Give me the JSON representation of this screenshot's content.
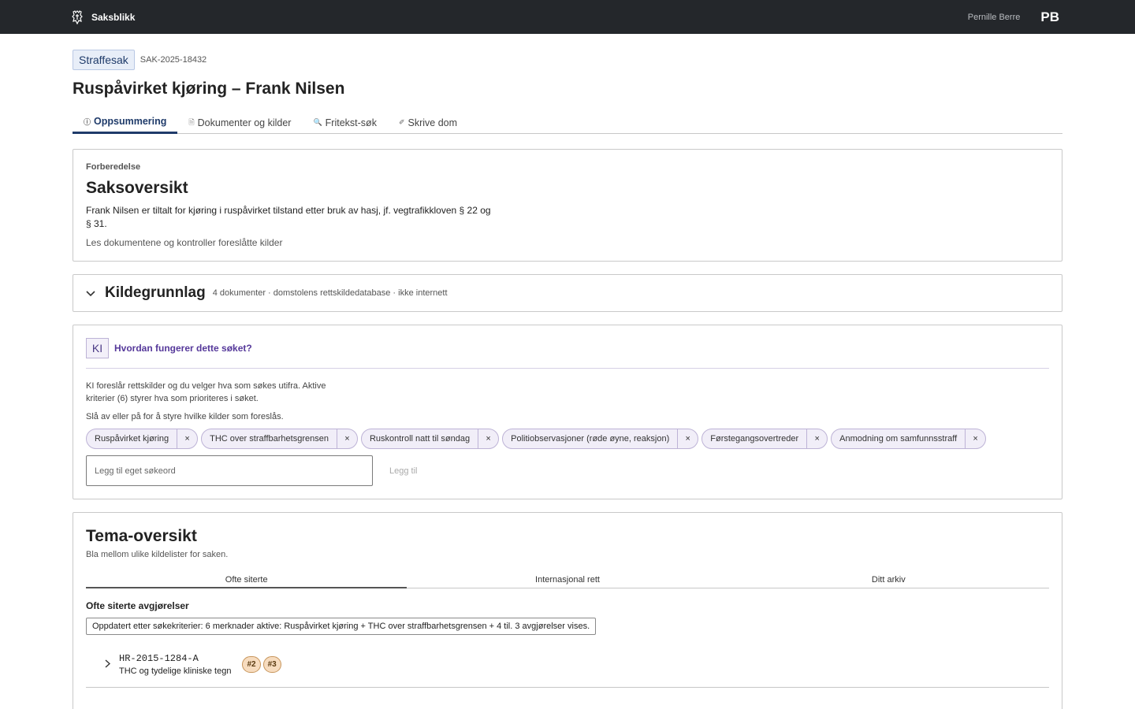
{
  "topbar": {
    "app_name": "Saksblikk",
    "user_name": "Pernille Berre",
    "user_initials": "PB"
  },
  "case": {
    "type": "Straffesak",
    "id": "SAK-2025-18432",
    "title": "Ruspåvirket kjøring – Frank Nilsen"
  },
  "tabs": [
    {
      "label": "Oppsummering",
      "icon": "info-icon",
      "active": true
    },
    {
      "label": "Dokumenter og kilder",
      "icon": "document-icon",
      "active": false
    },
    {
      "label": "Fritekst-søk",
      "icon": "search-icon",
      "active": false
    },
    {
      "label": "Skrive dom",
      "icon": "pen-icon",
      "active": false
    }
  ],
  "overview": {
    "overline": "Forberedelse",
    "title": "Saksoversikt",
    "summary": "Frank Nilsen er tiltalt for kjøring i ruspåvirket tilstand etter bruk av hasj, jf. vegtrafikkloven § 22 og § 31.",
    "instruction": "Les dokumentene og kontroller foreslåtte kilder"
  },
  "sources": {
    "title": "Kildegrunnlag",
    "meta": "4 dokumenter · domstolens rettskildedatabase · ikke internett"
  },
  "ki": {
    "badge": "KI",
    "link": "Hvordan fungerer dette søket?",
    "text": "KI foreslår rettskilder og du velger hva som søkes utifra. Aktive kriterier (6) styrer hva som prioriteres i søket.",
    "text2": "Slå av eller på for å styre hvilke kilder som foreslås.",
    "chips": [
      "Ruspåvirket kjøring",
      "THC over straffbarhetsgrensen",
      "Ruskontroll natt til søndag",
      "Politiobservasjoner (røde øyne, reaksjon)",
      "Førstegangsovertreder",
      "Anmodning om samfunnsstraff"
    ],
    "remove_glyph": "×",
    "input_placeholder": "Legg til eget søkeord",
    "add_label": "Legg til"
  },
  "tema": {
    "title": "Tema-oversikt",
    "subtitle": "Bla mellom ulike kildelister for saken.",
    "tabs": [
      "Ofte siterte",
      "Internasjonal rett",
      "Ditt arkiv"
    ],
    "active_tab": 0,
    "section_heading": "Ofte siterte avgjørelser",
    "update_note": "Oppdatert etter søkekriterier: 6 merknader aktive: Ruspåvirket kjøring + THC over straffbarhetsgrensen + 4 til. 3 avgjørelser vises.",
    "decisions": [
      {
        "ref": "HR-2015-1284-A",
        "title": "THC og tydelige kliniske tegn",
        "tags": [
          "#2",
          "#3"
        ]
      }
    ]
  },
  "colors": {
    "topbar": "#24272b",
    "accent": "#1f3b6a",
    "ki_purple": "#55389a",
    "tag_orange": "#f7dcbf"
  }
}
